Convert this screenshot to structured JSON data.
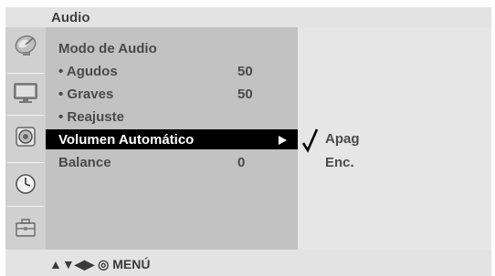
{
  "header": {
    "title": "Audio"
  },
  "sidebar": {
    "icons": [
      "satellite-dish-icon",
      "monitor-icon",
      "speaker-icon",
      "clock-icon",
      "toolbox-icon"
    ]
  },
  "menu": {
    "items": [
      {
        "label": "Modo de Audio",
        "value": ""
      },
      {
        "label": "• Agudos",
        "value": "50"
      },
      {
        "label": "• Graves",
        "value": "50"
      },
      {
        "label": "• Reajuste",
        "value": ""
      },
      {
        "label": "Volumen Automático",
        "value": "",
        "selected": true
      },
      {
        "label": "Balance",
        "value": "0"
      }
    ]
  },
  "submenu": {
    "options": [
      {
        "label": "Apag",
        "checked": true
      },
      {
        "label": "Enc.",
        "checked": false
      }
    ]
  },
  "footer": {
    "nav_hint": "▲▼◀▶ ◎ MENÚ"
  }
}
